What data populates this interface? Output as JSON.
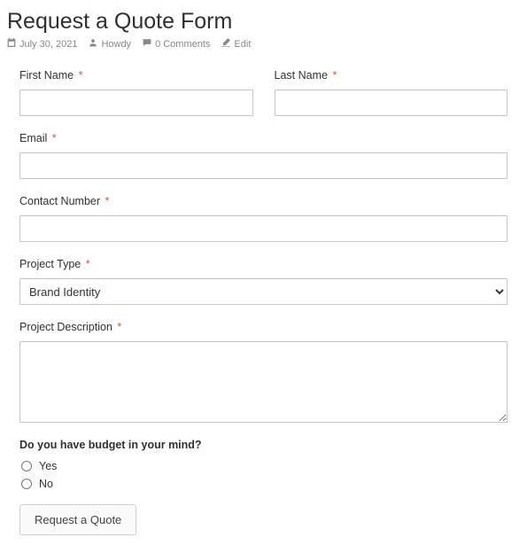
{
  "header": {
    "title": "Request a Quote Form",
    "meta": {
      "date": "July 30, 2021",
      "author": "Howdy",
      "comments": "0 Comments",
      "edit": "Edit"
    }
  },
  "form": {
    "first_name": {
      "label": "First Name",
      "required": "*",
      "value": ""
    },
    "last_name": {
      "label": "Last Name",
      "required": "*",
      "value": ""
    },
    "email": {
      "label": "Email",
      "required": "*",
      "value": ""
    },
    "contact_number": {
      "label": "Contact Number",
      "required": "*",
      "value": ""
    },
    "project_type": {
      "label": "Project Type",
      "required": "*",
      "selected": "Brand Identity"
    },
    "project_description": {
      "label": "Project Description",
      "required": "*",
      "value": ""
    },
    "budget": {
      "label": "Do you have budget in your mind?",
      "options": {
        "yes": "Yes",
        "no": "No"
      }
    },
    "submit_label": "Request a Quote"
  }
}
